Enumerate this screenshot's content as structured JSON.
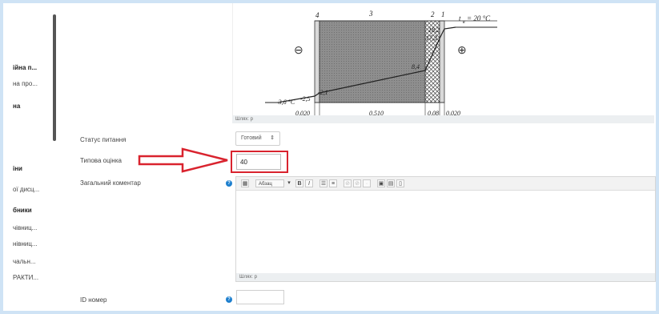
{
  "sidebar": {
    "items": [
      {
        "label": "ійна п...",
        "bold": true
      },
      {
        "label": "на про...",
        "bold": false
      },
      {
        "label": "на",
        "bold": true
      },
      {
        "label": "іни",
        "bold": true
      },
      {
        "label": "ої дисц...",
        "bold": false
      },
      {
        "label": "бники",
        "bold": true
      },
      {
        "label": "чівниц...",
        "bold": false
      },
      {
        "label": "нівниц...",
        "bold": false
      },
      {
        "label": "чальн...",
        "bold": false
      },
      {
        "label": "РАКТИ...",
        "bold": false
      }
    ]
  },
  "diagram": {
    "labels": {
      "n4": "4",
      "n3": "3",
      "n2": "2",
      "n1": "1",
      "tin": "t",
      "tin_sub": "в",
      "tin_val": "= 20 °C",
      "v182": "18,2",
      "v173": "17,3",
      "v84": "8,4",
      "v21": "-2,1",
      "v25": "-2,5",
      "v36": "-3,6 °C",
      "d1": "0,020",
      "d2": "0,510",
      "d3": "0,08",
      "d4": "0,020",
      "minus": "⊖",
      "plus": "⊕"
    },
    "path_text": "Шлях: p"
  },
  "form": {
    "status_label": "Статус питання",
    "status_value": "Готовий",
    "grade_label": "Типова оцінка",
    "grade_value": "40",
    "feedback_label": "Загальний коментар",
    "paragraph_select": "Абзац",
    "toolbar": {
      "bold": "B",
      "italic": "I"
    },
    "editor_path": "Шлях: p",
    "id_label": "ID номер",
    "id_value": ""
  },
  "colors": {
    "accent": "#d9232e",
    "help": "#1d7fce"
  },
  "icons": [
    "help-icon",
    "caret-down-icon",
    "bullet-list-icon",
    "numbered-list-icon",
    "link-icon",
    "image-icon",
    "media-icon",
    "paste-icon",
    "expand-toolbar-icon"
  ]
}
